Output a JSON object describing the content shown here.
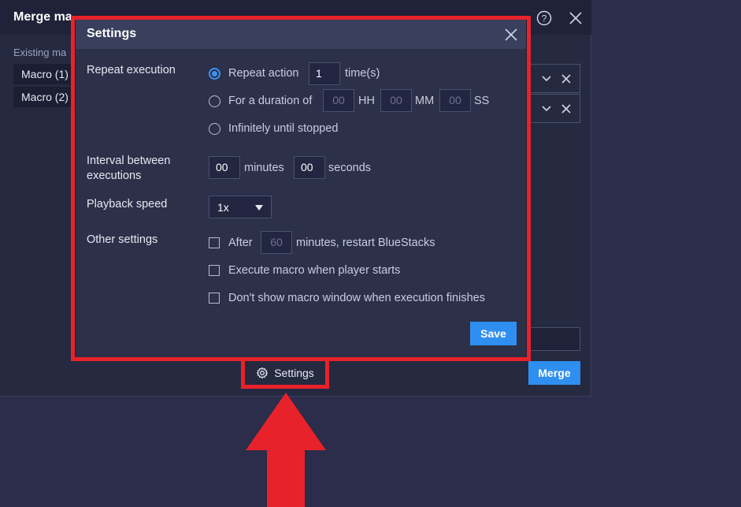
{
  "background_window": {
    "title": "Merge ma",
    "section_label": "Existing ma",
    "macros": [
      "Macro (1)",
      "Macro (2)"
    ],
    "merge_label": "Merge"
  },
  "settings_link": {
    "label": "Settings"
  },
  "dialog": {
    "title": "Settings",
    "repeat_execution": {
      "label": "Repeat execution",
      "repeat_action_label": "Repeat action",
      "repeat_count": "1",
      "times_suffix": "time(s)",
      "duration_label": "For a duration of",
      "hh_value": "00",
      "hh_unit": "HH",
      "mm_value": "00",
      "mm_unit": "MM",
      "ss_value": "00",
      "ss_unit": "SS",
      "infinite_label": "Infinitely until stopped",
      "selected": "repeat_action"
    },
    "interval": {
      "label_line1": "Interval between",
      "label_line2": "executions",
      "minutes_value": "00",
      "minutes_label": "minutes",
      "seconds_value": "00",
      "seconds_label": "seconds"
    },
    "playback_speed": {
      "label": "Playback speed",
      "value": "1x"
    },
    "other_settings": {
      "label": "Other settings",
      "after_label": "After",
      "restart_minutes": "60",
      "restart_suffix": "minutes, restart BlueStacks",
      "execute_on_start": "Execute macro when player starts",
      "hide_window": "Don't show macro window when execution finishes"
    },
    "save_label": "Save"
  },
  "colors": {
    "accent": "#2f8ff0",
    "annotation": "#e8222a"
  }
}
